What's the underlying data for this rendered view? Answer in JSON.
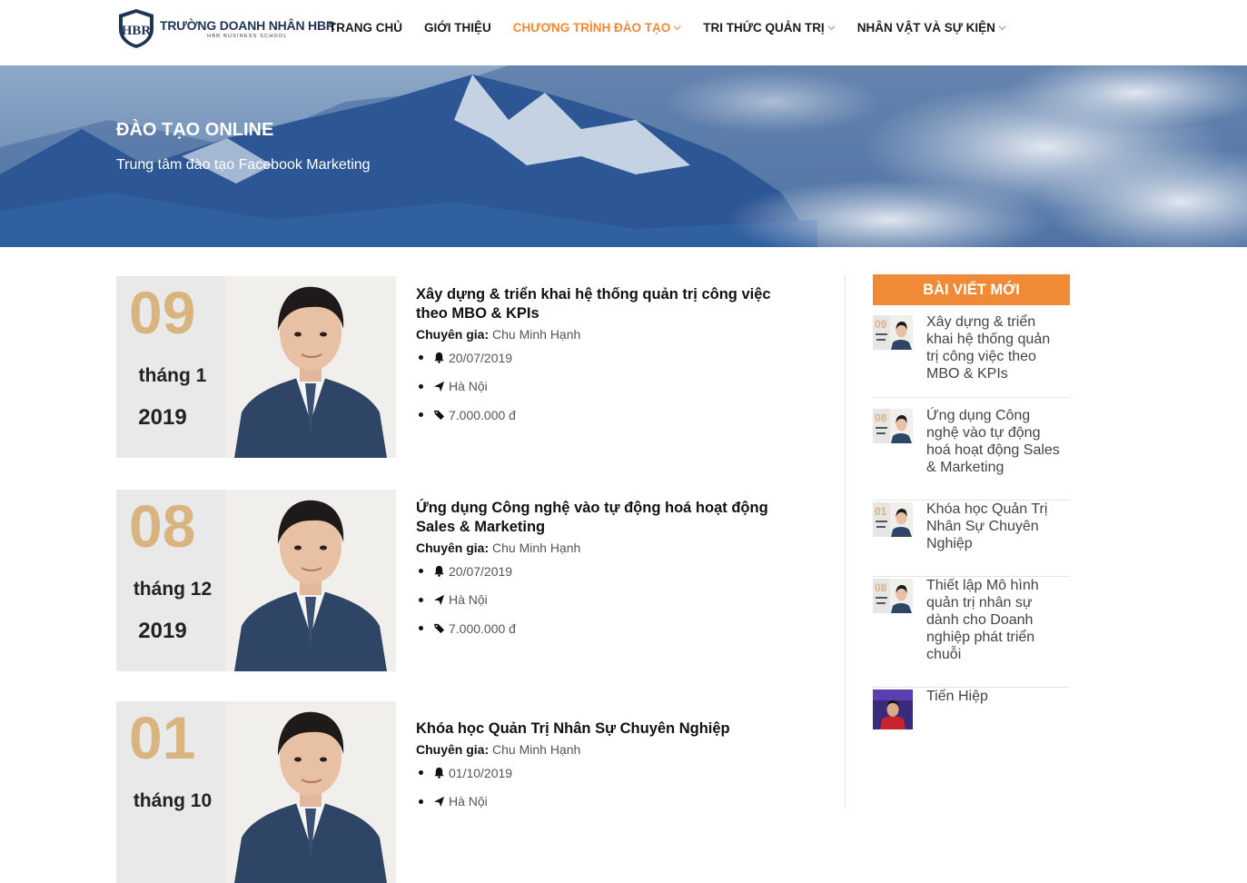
{
  "header": {
    "logo_text": "TRƯỜNG DOANH NHÂN HBR",
    "logo_sub": "HBR BUSINESS SCHOOL",
    "logo_mark": "HBR",
    "nav": [
      {
        "label": "TRANG CHỦ",
        "dropdown": false,
        "active": false
      },
      {
        "label": "GIỚI THIỆU",
        "dropdown": false,
        "active": false
      },
      {
        "label": "CHƯƠNG TRÌNH ĐÀO TẠO",
        "dropdown": true,
        "active": true
      },
      {
        "label": "TRI THỨC QUẢN TRỊ",
        "dropdown": true,
        "active": false
      },
      {
        "label": "NHÂN VẬT VÀ SỰ KIỆN",
        "dropdown": true,
        "active": false
      }
    ],
    "active_color": "#f08a36"
  },
  "banner": {
    "title": "ĐÀO TẠO ONLINE",
    "subtitle": "Trung tâm đào tạo Facebook Marketing"
  },
  "courses": [
    {
      "day": "09",
      "month": "tháng 1",
      "year": "2019",
      "title": "Xây dựng & triển khai hệ thống quản trị công việc theo MBO & KPIs",
      "expert_label": "Chuyên gia:",
      "expert": "Chu Minh Hạnh",
      "date": "20/07/2019",
      "location": "Hà Nội",
      "price": "7.000.000 đ"
    },
    {
      "day": "08",
      "month": "tháng 12",
      "year": "2019",
      "title": "Ứng dụng Công nghệ vào tự động hoá hoạt động Sales & Marketing",
      "expert_label": "Chuyên gia:",
      "expert": "Chu Minh Hạnh",
      "date": "20/07/2019",
      "location": "Hà Nội",
      "price": "7.000.000 đ"
    },
    {
      "day": "01",
      "month": "tháng 10",
      "year": "",
      "title": "Khóa học Quản Trị Nhân Sự Chuyên Nghiệp",
      "expert_label": "Chuyên gia:",
      "expert": "Chu Minh Hạnh",
      "date": "01/10/2019",
      "location": "Hà Nội",
      "price": ""
    }
  ],
  "sidebar": {
    "heading": "BÀI VIẾT MỚI",
    "heading_color": "#f08a36",
    "posts": [
      {
        "title": "Xây dựng & triển khai hệ thống quản trị công việc theo MBO & KPIs",
        "thumb_day": "09"
      },
      {
        "title": "Ứng dụng Công nghệ vào tự động hoá hoạt động Sales & Marketing",
        "thumb_day": "08"
      },
      {
        "title": "Khóa học Quản Trị Nhân Sự Chuyên Nghiệp",
        "thumb_day": "01"
      },
      {
        "title": "Thiết lập Mô hình quản trị nhân sự dành cho Doanh nghiệp phát triển chuỗi",
        "thumb_day": "08"
      },
      {
        "title": "Tiến Hiệp",
        "thumb_day": ""
      }
    ]
  },
  "icons": {
    "bell": "bell-icon",
    "location": "paper-plane-icon",
    "price": "tag-icon",
    "dropdown": "chevron-down-icon"
  }
}
